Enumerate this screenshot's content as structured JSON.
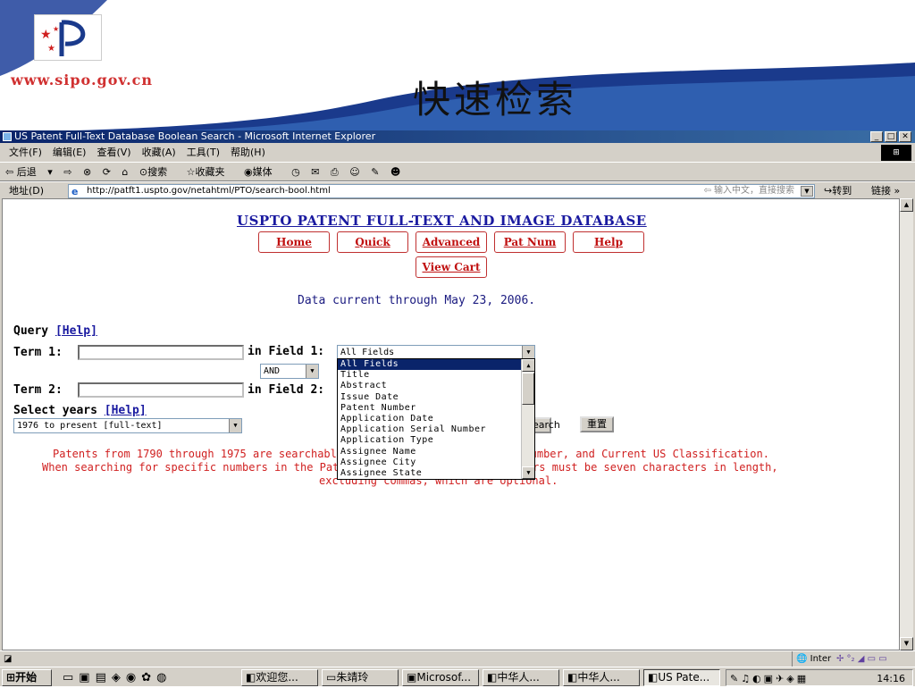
{
  "slide": {
    "url_text": "www.sipo.gov.cn",
    "title": "快速检索"
  },
  "browser": {
    "window_title": "US Patent Full-Text Database Boolean Search - Microsoft Internet Explorer",
    "menu": [
      "文件(F)",
      "编辑(E)",
      "查看(V)",
      "收藏(A)",
      "工具(T)",
      "帮助(H)"
    ],
    "toolbar": {
      "back": "⇦ 后退",
      "forward": "⇨",
      "search": "搜索",
      "favorites": "收藏夹",
      "media": "媒体"
    },
    "address_label": "地址(D)",
    "address": "http://patft1.uspto.gov/netahtml/PTO/search-bool.html",
    "address_hint": "⇦ 输入中文，直接搜索",
    "go": "转到",
    "links": "链接 »"
  },
  "page": {
    "db_title": "USPTO PATENT FULL-TEXT AND IMAGE DATABASE",
    "nav": {
      "home": "Home",
      "quick": "Quick",
      "advanced": "Advanced",
      "pat_num": "Pat Num",
      "help": "Help",
      "view_cart": "View Cart"
    },
    "data_current": "Data current through May 23, 2006.",
    "query_label": "Query",
    "help_link": "[Help]",
    "term1_label": "Term 1:",
    "field1_label": "in Field 1:",
    "field1_value": "All Fields",
    "operator_value": "AND",
    "term2_label": "Term 2:",
    "field2_label": "in Field 2:",
    "select_years_label": "Select years",
    "years_value": "1976 to present [full-text]",
    "search_button": "Search",
    "reset_button": "重置",
    "field_options": [
      "All Fields",
      "Title",
      "Abstract",
      "Issue Date",
      "Patent Number",
      "Application Date",
      "Application Serial Number",
      "Application Type",
      "Assignee Name",
      "Assignee City",
      "Assignee State"
    ],
    "note_line1": "Patents from 1790 through 1975 are searchable only by Issue Date, Patent Number, and Current US Classification.",
    "note_line2": "When searching for specific numbers in the Patent Number field, patent numbers must be seven characters in length,",
    "note_line3": "excluding commas, which are optional."
  },
  "status": {
    "zone": "Inter"
  },
  "taskbar": {
    "start": "开始",
    "tasks": [
      "欢迎您...",
      "朱靖玲",
      "Microsof...",
      "中华人...",
      "中华人...",
      "US Pate..."
    ],
    "clock": "14:16"
  }
}
